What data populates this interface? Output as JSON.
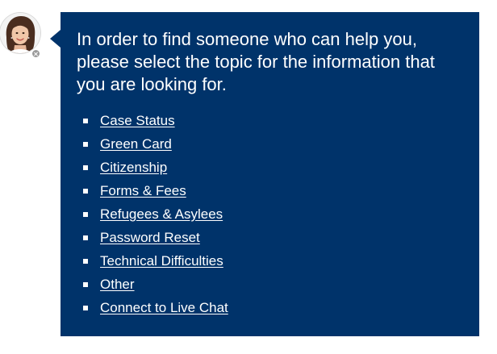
{
  "agent": {
    "avatar_icon": "agent-avatar-icon",
    "status_icon": "close-icon"
  },
  "chat": {
    "message": "In order to find someone who can help you, please select the topic for the information that you are looking for.",
    "topics": [
      {
        "label": "Case Status"
      },
      {
        "label": "Green Card"
      },
      {
        "label": "Citizenship"
      },
      {
        "label": "Forms & Fees"
      },
      {
        "label": "Refugees & Asylees"
      },
      {
        "label": "Password Reset"
      },
      {
        "label": "Technical Difficulties"
      },
      {
        "label": "Other"
      },
      {
        "label": "Connect to Live Chat"
      }
    ]
  },
  "colors": {
    "bubble_background": "#00336a",
    "text": "#ffffff",
    "status_dot": "#9a9a9a"
  }
}
